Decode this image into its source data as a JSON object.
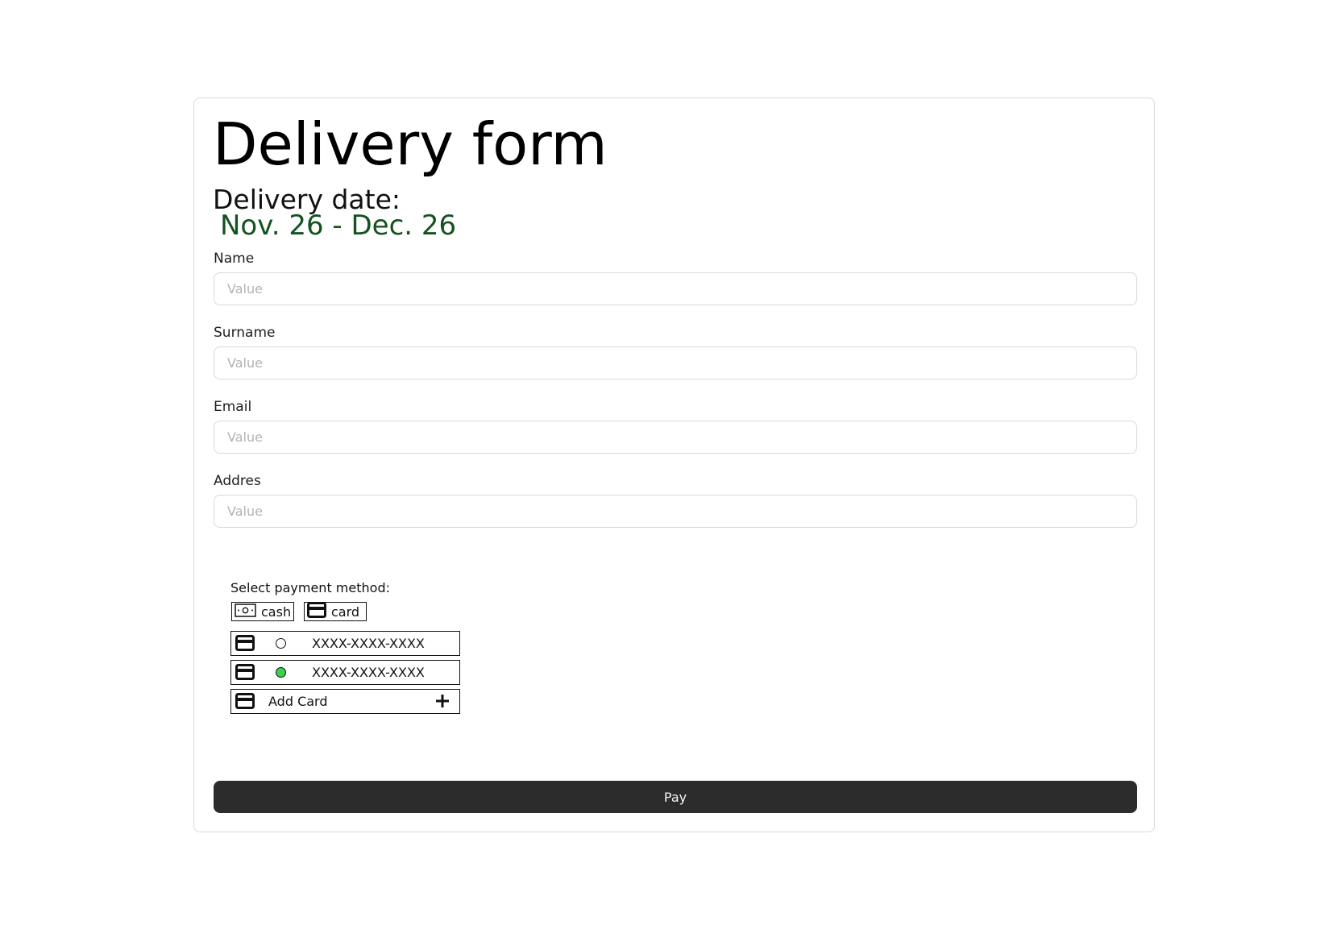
{
  "form": {
    "title": "Delivery form",
    "delivery_date_label": "Delivery date:",
    "delivery_date_range": "Nov. 26 - Dec. 26",
    "delivery_date_color": "#14521e",
    "fields": [
      {
        "label": "Name",
        "placeholder": "Value",
        "value": ""
      },
      {
        "label": "Surname",
        "placeholder": "Value",
        "value": ""
      },
      {
        "label": "Email",
        "placeholder": "Value",
        "value": ""
      },
      {
        "label": "Addres",
        "placeholder": "Value",
        "value": ""
      }
    ]
  },
  "payment": {
    "label": "Select payment method:",
    "methods": [
      {
        "label": "cash",
        "icon": "cash-icon"
      },
      {
        "label": "card",
        "icon": "credit-card-icon"
      }
    ],
    "saved_cards": [
      {
        "number": "XXXX-XXXX-XXXX",
        "selected": false
      },
      {
        "number": "XXXX-XXXX-XXXX",
        "selected": true
      }
    ],
    "add_card_label": "Add Card",
    "selected_color": "#3ccf4e"
  },
  "pay_button": {
    "label": "Pay",
    "color": "#2c2c2c"
  }
}
